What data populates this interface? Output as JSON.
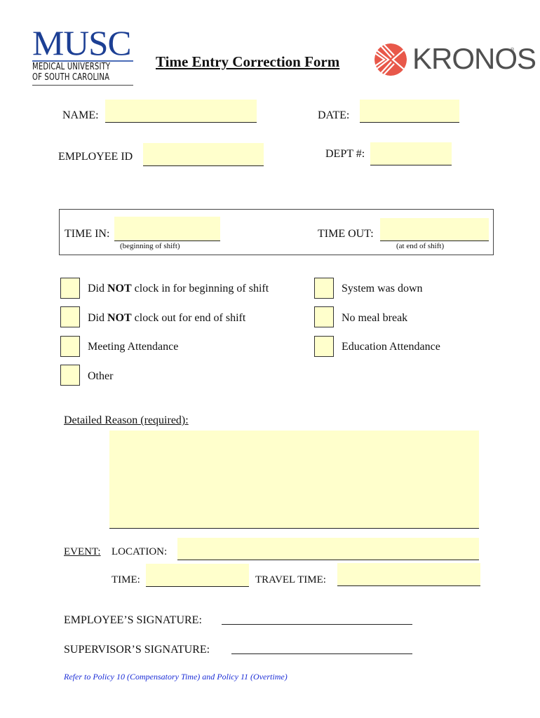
{
  "header": {
    "musc_logo": {
      "wordmark": "MUSC",
      "line1": "MEDICAL UNIVERSITY",
      "line2": "OF SOUTH CAROLINA"
    },
    "title": "Time Entry Correction Form",
    "kronos_logo": {
      "wordmark": "KRONOS",
      "reg": "®"
    },
    "colors": {
      "musc_blue": "#1c3f94",
      "kronos_red": "#e8584a",
      "field_fill": "#ffffcc",
      "policy_blue": "#1a2cd6"
    }
  },
  "fields": {
    "name": {
      "label": "NAME:",
      "value": ""
    },
    "date": {
      "label": "DATE:",
      "value": ""
    },
    "employee_id": {
      "label": "EMPLOYEE ID",
      "value": ""
    },
    "dept": {
      "label": "DEPT #:",
      "value": ""
    },
    "time_in": {
      "label": "TIME IN:",
      "hint": "(beginning of shift)",
      "value": ""
    },
    "time_out": {
      "label": "TIME OUT:",
      "hint": "(at end of shift)",
      "value": ""
    }
  },
  "checkboxes": [
    {
      "pre": "Did ",
      "bold": "NOT",
      "post": " clock in for beginning of shift",
      "checked": false
    },
    {
      "pre": "Did ",
      "bold": "NOT",
      "post": " clock out for end of shift",
      "checked": false
    },
    {
      "pre": "",
      "bold": "",
      "post": "Meeting Attendance",
      "checked": false
    },
    {
      "pre": "",
      "bold": "",
      "post": "Other",
      "checked": false
    },
    {
      "pre": "",
      "bold": "",
      "post": "System was down",
      "checked": false
    },
    {
      "pre": "",
      "bold": "",
      "post": "No meal break",
      "checked": false
    },
    {
      "pre": "",
      "bold": "",
      "post": "Education Attendance",
      "checked": false
    }
  ],
  "reason": {
    "label": "Detailed Reason (required):",
    "value": ""
  },
  "event": {
    "label": "EVENT:",
    "location_label": "LOCATION:",
    "time_label": "TIME:",
    "travel_time_label": "TRAVEL TIME:",
    "location": "",
    "time": "",
    "travel_time": ""
  },
  "signatures": {
    "employee_label": "EMPLOYEE’S SIGNATURE:",
    "supervisor_label": "SUPERVISOR’S SIGNATURE:"
  },
  "footer": {
    "policy_note": "Refer to Policy 10 (Compensatory Time) and Policy 11 (Overtime)"
  }
}
